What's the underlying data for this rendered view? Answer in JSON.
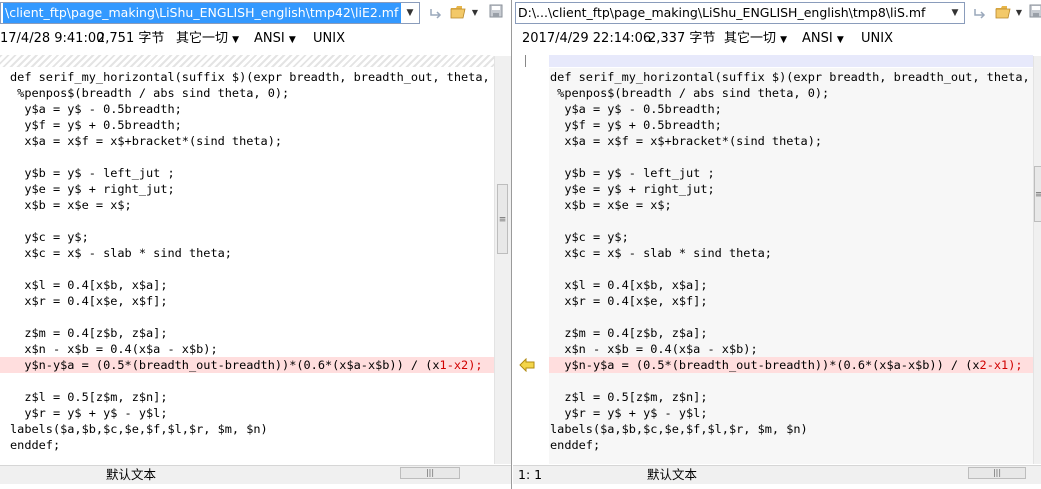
{
  "left": {
    "path": "\\client_ftp\\page_making\\LiShu_ENGLISH_english\\tmp42\\liE2.mf",
    "info": {
      "date": "17/4/28 9:41:00",
      "size": "2,751 字节",
      "other": "其它一切",
      "encoding": "ANSI",
      "lineend": "UNIX"
    },
    "status": {
      "position": "",
      "mode": "默认文本"
    }
  },
  "right": {
    "path": "D:\\...\\client_ftp\\page_making\\LiShu_ENGLISH_english\\tmp8\\liS.mf",
    "info": {
      "date": "2017/4/29 22:14:06",
      "size": "2,337 字节",
      "other": "其它一切",
      "encoding": "ANSI",
      "lineend": "UNIX"
    },
    "status": {
      "position": "1: 1",
      "mode": "默认文本"
    }
  },
  "code_lines": [
    "def serif_my_horizontal(suffix $)(expr breadth, breadth_out, theta, l",
    " %penpos$(breadth / abs sind theta, 0);",
    "  y$a = y$ - 0.5breadth;",
    "  y$f = y$ + 0.5breadth;",
    "  x$a = x$f = x$+bracket*(sind theta);",
    "",
    "  y$b = y$ - left_jut ;",
    "  y$e = y$ + right_jut;",
    "  x$b = x$e = x$;",
    "",
    "  y$c = y$;",
    "  x$c = x$ - slab * sind theta;",
    "",
    "  x$l = 0.4[x$b, x$a];",
    "  x$r = 0.4[x$e, x$f];",
    "",
    "  z$m = 0.4[z$b, z$a];",
    "  x$n - x$b = 0.4(x$a - x$b);",
    "DIFF",
    "",
    "  z$l = 0.5[z$m, z$n];",
    "  y$r = y$ + y$ - y$l;",
    "labels($a,$b,$c,$e,$f,$l,$r, $m, $n)",
    "enddef;"
  ],
  "diff_line": {
    "left": {
      "prefix": "  y$n-y$a = (0.5*(breadth_out-breadth))*(0.6*(x$a-x$b)) / (x",
      "a": "1",
      "mid": "-x",
      "b": "2",
      "suffix": ");"
    },
    "right": {
      "prefix": "  y$n-y$a = (0.5*(breadth_out-breadth))*(0.6*(x$a-x$b)) / (x",
      "a": "2",
      "mid": "-x",
      "b": "1",
      "suffix": ");"
    }
  },
  "icons": [
    "back-arrow-icon",
    "folder-open-icon",
    "save-icon",
    "copy-left-arrow-icon"
  ],
  "colors": {
    "diff_bg": "#ffdede",
    "diff_text": "#d00000",
    "selection": "#3399ff",
    "arrow": "#e6b800"
  }
}
